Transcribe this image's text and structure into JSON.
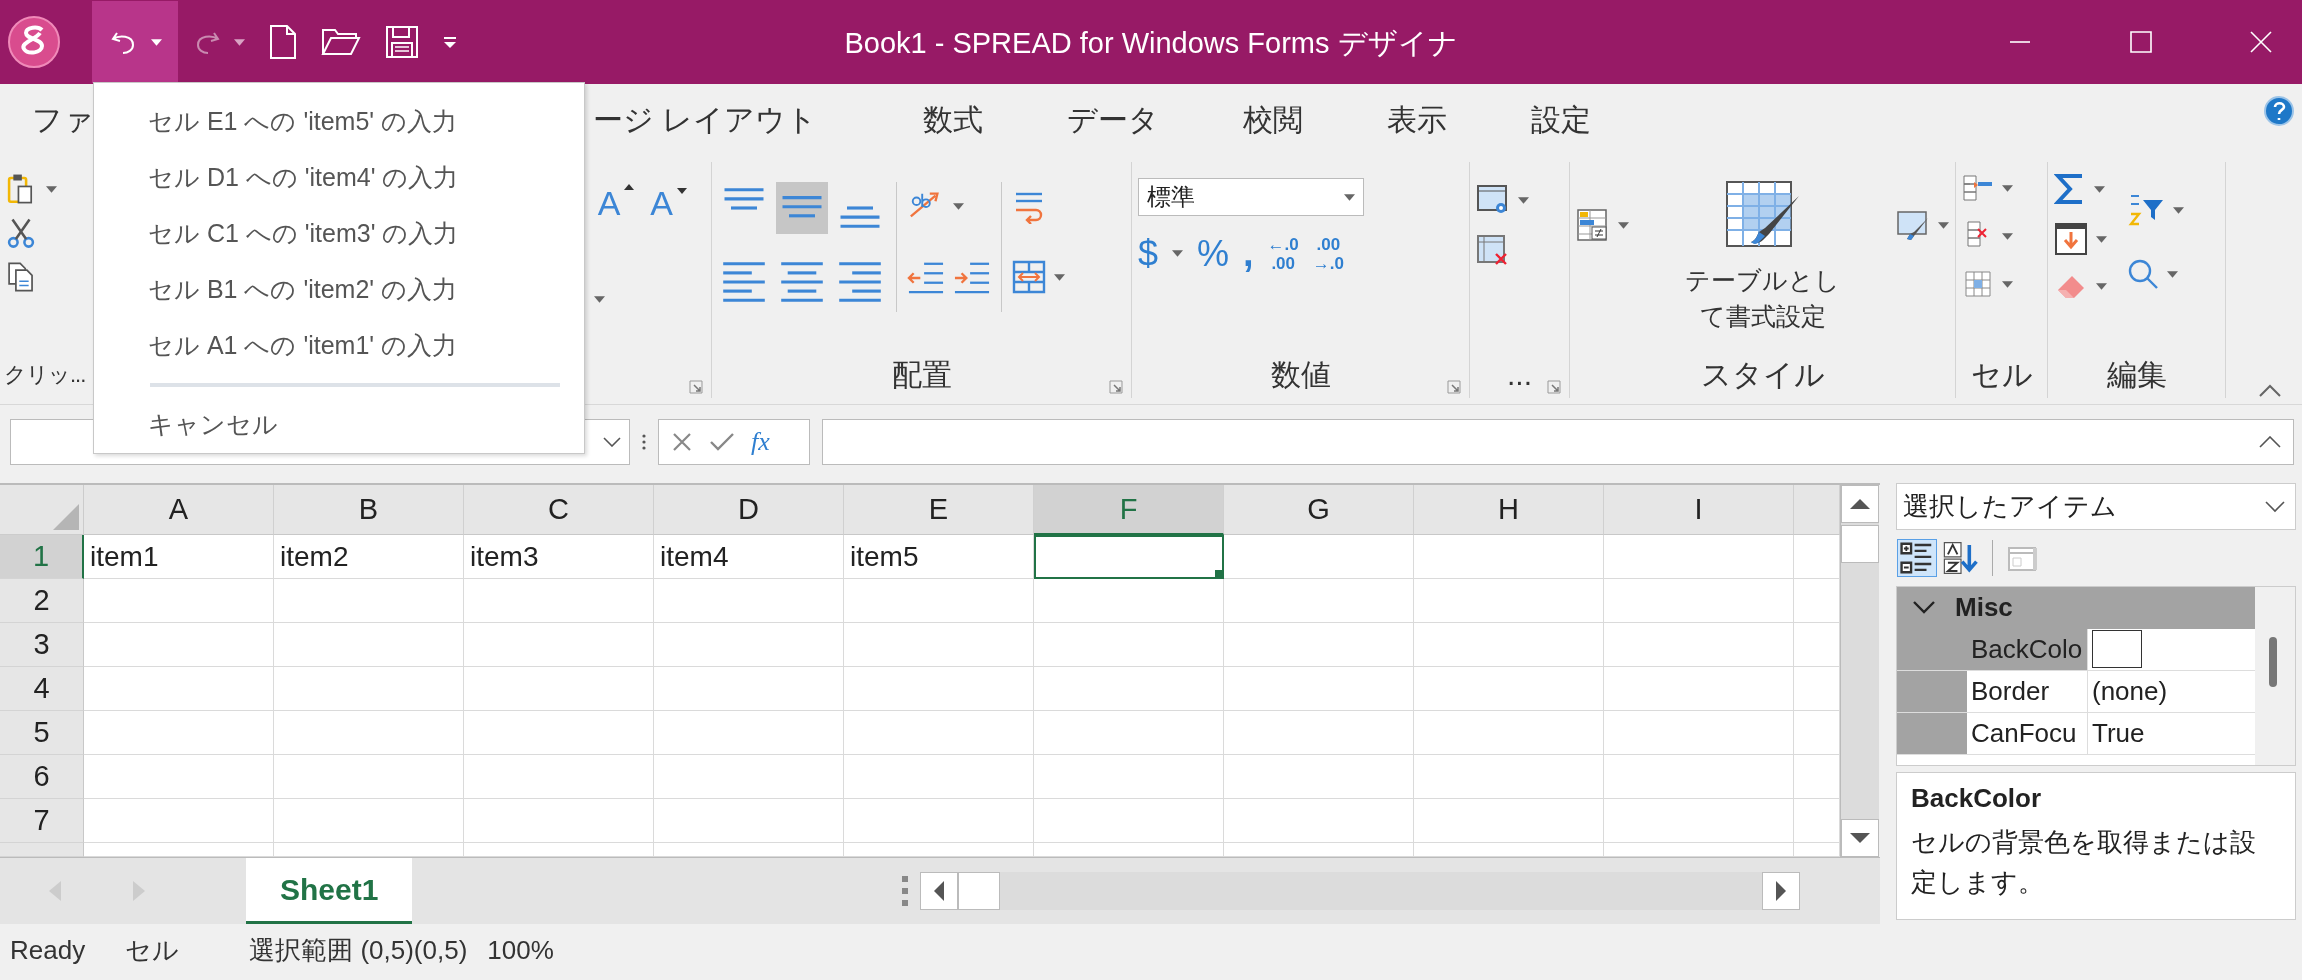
{
  "title_bar": {
    "title": "Book1 - SPREAD for Windows Forms デザイナ"
  },
  "undo_menu": {
    "open": true,
    "items": [
      "セル E1 への 'item5' の入力",
      "セル D1 への 'item4' の入力",
      "セル C1 への 'item3' の入力",
      "セル B1 への 'item2' の入力",
      "セル A1 への 'item1' の入力"
    ],
    "cancel": "キャンセル"
  },
  "menu_tabs": [
    "ファ",
    "ージ レイアウト",
    "数式",
    "データ",
    "校閲",
    "表示",
    "設定"
  ],
  "ribbon": {
    "groups": [
      {
        "kind": "clipboard",
        "label": "クリッ..."
      },
      {
        "kind": "font",
        "glyphs": [
          "A",
          "A"
        ]
      },
      {
        "kind": "alignment",
        "label": "配置",
        "buttons": [
          {
            "selected": false
          },
          {
            "selected": true
          },
          {
            "selected": false
          },
          {
            "selected": false
          },
          {
            "selected": false
          },
          {
            "selected": false
          }
        ]
      },
      {
        "kind": "number",
        "label": "数値",
        "format": "標準",
        "glyphs": [
          "$",
          "%",
          ","
        ],
        "decimals": [
          [
            "←.0",
            ".00"
          ],
          [
            ".00",
            "→.0"
          ]
        ]
      },
      {
        "kind": "format",
        "label": "..."
      },
      {
        "kind": "style",
        "label": "スタイル",
        "table_button": "テーブルとして書式設定"
      },
      {
        "kind": "cells",
        "label": "セル"
      },
      {
        "kind": "editing",
        "label": "編集"
      }
    ]
  },
  "formula_bar": {
    "function_label": "fx"
  },
  "sheet": {
    "columns": [
      {
        "label": "A",
        "selected": false
      },
      {
        "label": "B",
        "selected": false
      },
      {
        "label": "C",
        "selected": false
      },
      {
        "label": "D",
        "selected": false
      },
      {
        "label": "E",
        "selected": false
      },
      {
        "label": "F",
        "selected": true
      },
      {
        "label": "G",
        "selected": false
      },
      {
        "label": "H",
        "selected": false
      },
      {
        "label": "I",
        "selected": false
      }
    ],
    "rows": [
      {
        "header": "1",
        "selected": true,
        "cells": [
          "item1",
          "item2",
          "item3",
          "item4",
          "item5"
        ]
      },
      {
        "header": "2",
        "selected": false
      },
      {
        "header": "3",
        "selected": false
      },
      {
        "header": "4",
        "selected": false
      },
      {
        "header": "5",
        "selected": false
      },
      {
        "header": "6",
        "selected": false
      },
      {
        "header": "7",
        "selected": false
      }
    ]
  },
  "sheet_tabs": [
    {
      "label": "Sheet1",
      "selected": true
    }
  ],
  "property_panel": {
    "selector": "選択したアイテム",
    "view_buttons": [
      {
        "selected": true
      },
      {
        "selected": false
      }
    ],
    "category": {
      "label": "Misc",
      "expanded": true
    },
    "properties": [
      {
        "name": "BackColo",
        "kind": "swatch",
        "selected": true
      },
      {
        "name": "Border",
        "kind": "text",
        "value": "(none)",
        "selected": false
      },
      {
        "name": "CanFocu",
        "kind": "text",
        "value": "True",
        "selected": false
      }
    ],
    "description": {
      "title": "BackColor",
      "text": "セルの背景色を取得または設定します。"
    }
  },
  "status_bar": [
    "Ready",
    "セル",
    "選択範囲 (0,5)(0,5)",
    "100%"
  ]
}
